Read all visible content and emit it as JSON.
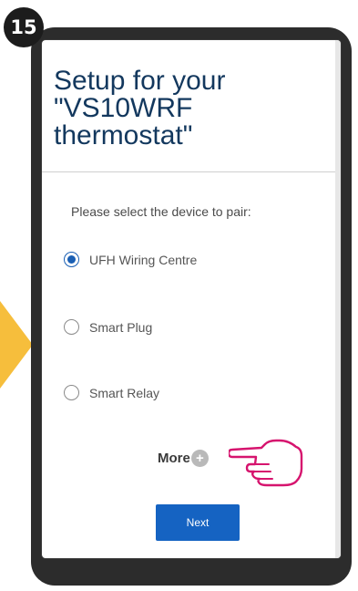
{
  "step": {
    "number": "15"
  },
  "setup": {
    "title": "Setup for your\n\"VS10WRF\nthermostat\"",
    "prompt": "Please select the device to pair:",
    "options": [
      {
        "label": "UFH Wiring Centre",
        "selected": true
      },
      {
        "label": "Smart Plug",
        "selected": false
      },
      {
        "label": "Smart Relay",
        "selected": false
      }
    ],
    "more_label": "More",
    "more_icon": "+",
    "next_label": "Next"
  },
  "colors": {
    "title": "#13385e",
    "accent": "#1563c2",
    "pointer": "#d6146e",
    "arrow": "#f6be3c",
    "phone_frame": "#2c2c2c"
  },
  "icons": {
    "pointer": "pointing-hand-icon",
    "more": "plus-circle-icon",
    "step_arrow": "arrow-right-icon"
  }
}
